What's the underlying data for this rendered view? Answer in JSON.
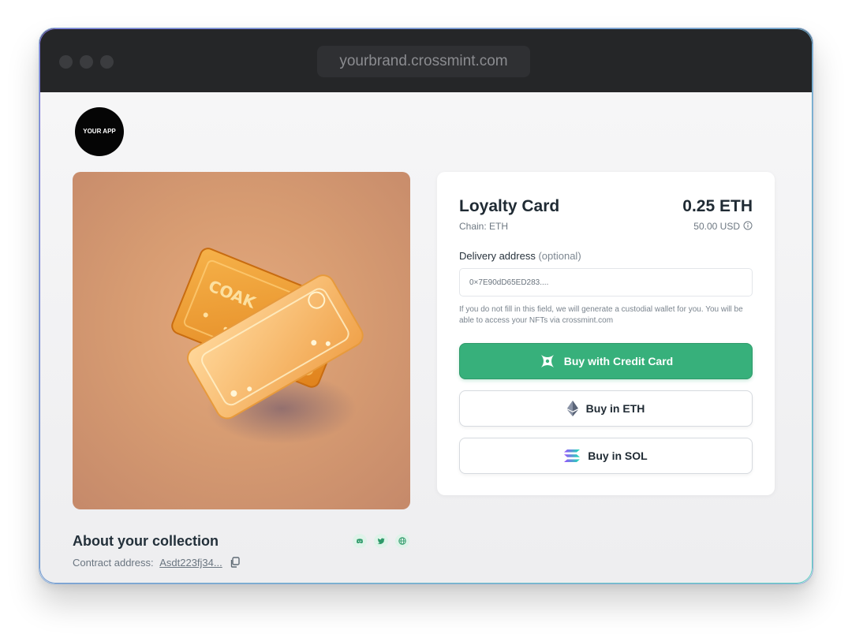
{
  "browser": {
    "url": "yourbrand.crossmint.com"
  },
  "app": {
    "logo_text": "YOUR APP"
  },
  "product": {
    "title": "Loyalty Card",
    "price": "0.25 ETH",
    "chain": "Chain: ETH",
    "usd_price": "50.00 USD"
  },
  "delivery": {
    "label": "Delivery address",
    "optional": "(optional)",
    "value": "0×7E90dD65ED283....",
    "hint": "If you do not fill in this field, we will generate a custodial wallet for you. You will be able to access your NFTs via crossmint.com"
  },
  "buttons": {
    "credit_card": "Buy with Credit Card",
    "eth": "Buy in ETH",
    "sol": "Buy in SOL"
  },
  "collection": {
    "title": "About your collection",
    "contract_label": "Contract address:",
    "contract_address": "Asdt223fj34..."
  },
  "icons": {
    "credit_card": "crossmint-x-icon",
    "eth": "ethereum-icon",
    "sol": "solana-icon",
    "discord": "discord-icon",
    "twitter": "twitter-icon",
    "website": "globe-icon",
    "copy": "copy-icon",
    "info": "info-icon"
  },
  "colors": {
    "accent": "#37b07b",
    "titlebar": "#252628",
    "social_icon": "#2f9a6a"
  }
}
